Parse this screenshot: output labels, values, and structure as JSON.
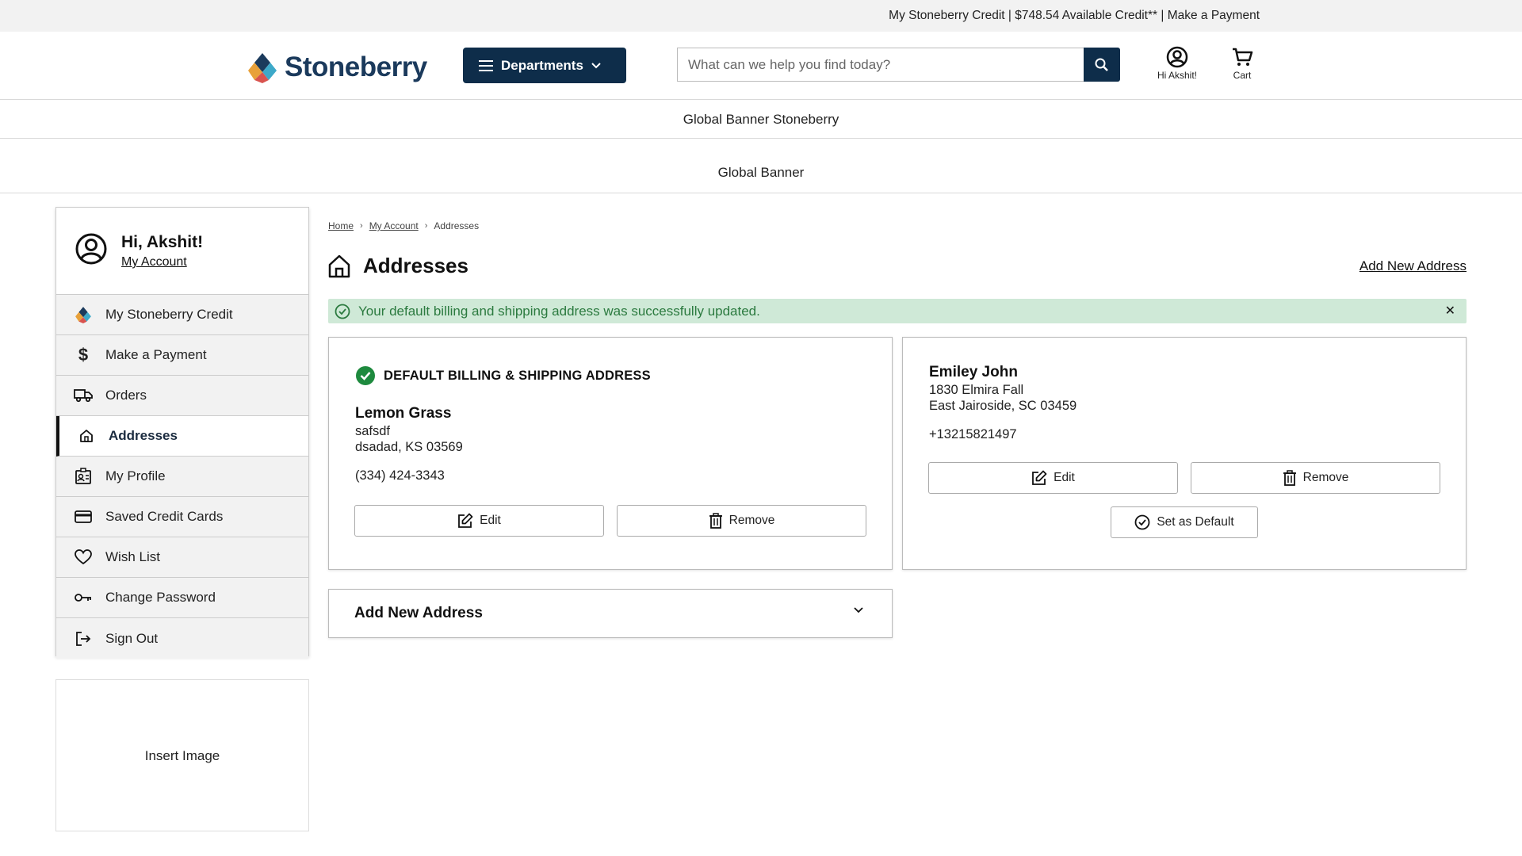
{
  "top_strip": {
    "text": "My Stoneberry Credit | $748.54 Available Credit** | Make a Payment"
  },
  "header": {
    "logo_text": "Stoneberry",
    "departments_label": "Departments",
    "search_placeholder": "What can we help you find today?",
    "account_label": "Hi Akshit!",
    "cart_label": "Cart"
  },
  "banners": {
    "primary": "Global Banner Stoneberry",
    "secondary": "Global Banner"
  },
  "sidebar": {
    "greeting": "Hi, Akshit!",
    "account_link": "My Account",
    "items": [
      {
        "label": "My Stoneberry Credit",
        "icon": "stoneberry-logo-icon"
      },
      {
        "label": "Make a Payment",
        "icon": "dollar-icon"
      },
      {
        "label": "Orders",
        "icon": "truck-icon"
      },
      {
        "label": "Addresses",
        "icon": "home-icon",
        "active": true
      },
      {
        "label": "My Profile",
        "icon": "profile-card-icon"
      },
      {
        "label": "Saved Credit Cards",
        "icon": "credit-card-icon"
      },
      {
        "label": "Wish List",
        "icon": "heart-icon"
      },
      {
        "label": "Change Password",
        "icon": "key-icon"
      },
      {
        "label": "Sign Out",
        "icon": "sign-out-icon"
      }
    ],
    "insert_image": "Insert Image"
  },
  "breadcrumb": [
    "Home",
    "My Account",
    "Addresses"
  ],
  "page": {
    "title": "Addresses",
    "add_new_link": "Add New Address"
  },
  "alert": {
    "message": "Your default billing and shipping address was successfully updated.",
    "close": "✕"
  },
  "addresses": [
    {
      "default_label": "DEFAULT BILLING & SHIPPING ADDRESS",
      "name": "Lemon Grass",
      "line1": "safsdf",
      "line2": "dsadad, KS 03569",
      "phone": "(334) 424-3343",
      "edit": "Edit",
      "remove": "Remove"
    },
    {
      "name": "Emiley John",
      "line1": "1830 Elmira Fall",
      "line2": "East Jairoside, SC 03459",
      "phone": "+13215821497",
      "edit": "Edit",
      "remove": "Remove",
      "set_default": "Set as Default"
    }
  ],
  "accordion": {
    "label": "Add New Address"
  },
  "colors": {
    "navy": "#0e2d4a",
    "alert_bg": "#cfe9d7",
    "alert_text": "#2b7a3f",
    "check_green": "#1e8a3e"
  }
}
